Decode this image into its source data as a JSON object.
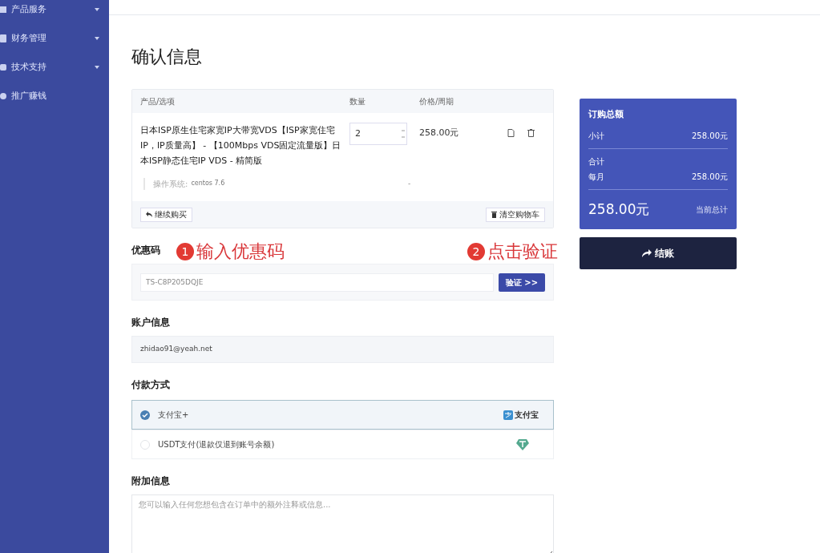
{
  "sidebar": {
    "items": [
      {
        "label": "产品服务",
        "expandable": true
      },
      {
        "label": "财务管理",
        "expandable": true
      },
      {
        "label": "技术支持",
        "expandable": true
      },
      {
        "label": "推广赚钱",
        "expandable": false
      }
    ]
  },
  "page_title": "确认信息",
  "cart": {
    "columns": [
      "产品/选项",
      "数量",
      "价格/周期"
    ],
    "items": [
      {
        "name": "日本ISP原生住宅家宽IP大带宽VDS【ISP家宽住宅IP，IP质量高】 - 【100Mbps VDS固定流量版】日本ISP静态住宅IP VDS - 精简版",
        "quantity": "2",
        "price": "258.00元",
        "option_label": "操作系统:",
        "option_value": "centos 7.6",
        "option_price": "-"
      }
    ],
    "continue_button": "继续购买",
    "clear_button": "清空购物车"
  },
  "coupon": {
    "heading": "优惠码",
    "value": "TS-C8P205DQJE",
    "button": "验证 >>"
  },
  "annotations": [
    {
      "number": "1",
      "text": "输入优惠码"
    },
    {
      "number": "2",
      "text": "点击验证"
    }
  ],
  "account": {
    "heading": "账户信息",
    "email": "zhidao91@yeah.net"
  },
  "payment": {
    "heading": "付款方式",
    "methods": [
      {
        "label": "支付宝+",
        "selected": true,
        "kind": "alipay",
        "logo_text": "支付宝"
      },
      {
        "label": "USDT支付(退款仅退到账号余额)",
        "selected": false,
        "kind": "usdt"
      }
    ]
  },
  "notes": {
    "heading": "附加信息",
    "placeholder": "您可以输入任何您想包含在订单中的额外注释或信息..."
  },
  "summary": {
    "title": "订购总额",
    "subtotal_label": "小计",
    "subtotal": "258.00元",
    "total_label": "合计",
    "period_label": "每月",
    "period_total": "258.00元",
    "grand_total": "258.00元",
    "grand_total_label": "当前总计",
    "checkout_button": "结账"
  }
}
